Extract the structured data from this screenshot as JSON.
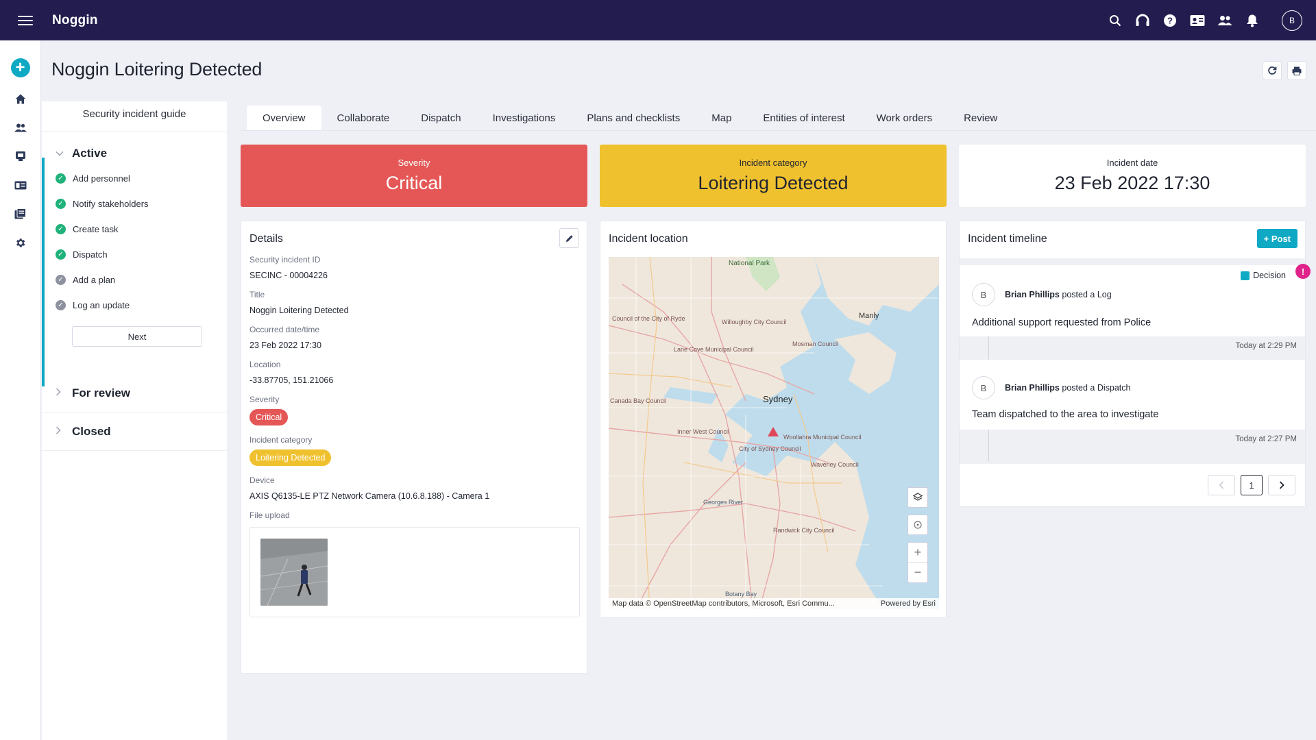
{
  "app": {
    "brand": "Noggin",
    "user_initial": "B"
  },
  "page": {
    "title": "Noggin Loitering Detected"
  },
  "guide": {
    "title": "Security incident guide",
    "active_label": "Active",
    "steps": [
      {
        "label": "Add personnel",
        "done": true
      },
      {
        "label": "Notify stakeholders",
        "done": true
      },
      {
        "label": "Create task",
        "done": true
      },
      {
        "label": "Dispatch",
        "done": true
      },
      {
        "label": "Add a plan",
        "done": false
      },
      {
        "label": "Log an update",
        "done": false
      }
    ],
    "next_label": "Next",
    "for_review_label": "For review",
    "closed_label": "Closed"
  },
  "tabs": [
    "Overview",
    "Collaborate",
    "Dispatch",
    "Investigations",
    "Plans and checklists",
    "Map",
    "Entities of interest",
    "Work orders",
    "Review"
  ],
  "summary": {
    "severity_caption": "Severity",
    "severity_value": "Critical",
    "category_caption": "Incident category",
    "category_value": "Loitering Detected",
    "date_caption": "Incident date",
    "date_value": "23 Feb 2022 17:30"
  },
  "details": {
    "title": "Details",
    "id_label": "Security incident ID",
    "id_value": "SECINC - 00004226",
    "title_label": "Title",
    "title_value": "Noggin Loitering Detected",
    "occurred_label": "Occurred date/time",
    "occurred_value": "23 Feb 2022 17:30",
    "location_label": "Location",
    "location_value": "-33.87705, 151.21066",
    "severity_label": "Severity",
    "severity_value": "Critical",
    "category_label": "Incident category",
    "category_value": "Loitering Detected",
    "device_label": "Device",
    "device_value": "AXIS Q6135-LE PTZ Network Camera (10.6.8.188) - Camera 1",
    "upload_label": "File upload"
  },
  "location": {
    "title": "Incident location",
    "attribution": "Map data © OpenStreetMap contributors, Microsoft, Esri Commu...",
    "powered_by": "Powered by Esri",
    "map_labels": [
      "National Park",
      "Manly",
      "Sydney",
      "Botany Bay",
      "Council of the City of Ryde",
      "Willoughby City Council",
      "Mosman Council",
      "Lane Cove Municipal Council",
      "Inner West Council",
      "City of Sydney Council",
      "Randwick City Council",
      "Waverley Council",
      "Woollahra Municipal Council",
      "Canada Bay Council",
      "Georges River"
    ]
  },
  "timeline": {
    "title": "Incident timeline",
    "post_label": "+ Post",
    "decision_label": "Decision",
    "alert_mark": "!",
    "entries": [
      {
        "avatar": "B",
        "author": "Brian Phillips",
        "action": "posted a",
        "type": "Log",
        "message": "Additional support requested from Police",
        "time": "Today at 2:29 PM"
      },
      {
        "avatar": "B",
        "author": "Brian Phillips",
        "action": "posted a",
        "type": "Dispatch",
        "message": "Team dispatched to the area to investigate",
        "time": "Today at 2:27 PM"
      }
    ],
    "page": "1"
  },
  "colors": {
    "topbar": "#231d4f",
    "accent": "#0fa9c4",
    "critical": "#e45756",
    "warning": "#f0c12f",
    "success": "#1fb27a",
    "alert": "#e0238a"
  },
  "icons": {
    "topbar": [
      "search-icon",
      "headset-icon",
      "help-icon",
      "contact-card-icon",
      "people-icon",
      "bell-icon"
    ],
    "rail": [
      "add-icon",
      "home-icon",
      "people-icon",
      "incident-icon",
      "id-card-icon",
      "library-icon",
      "settings-icon"
    ]
  }
}
